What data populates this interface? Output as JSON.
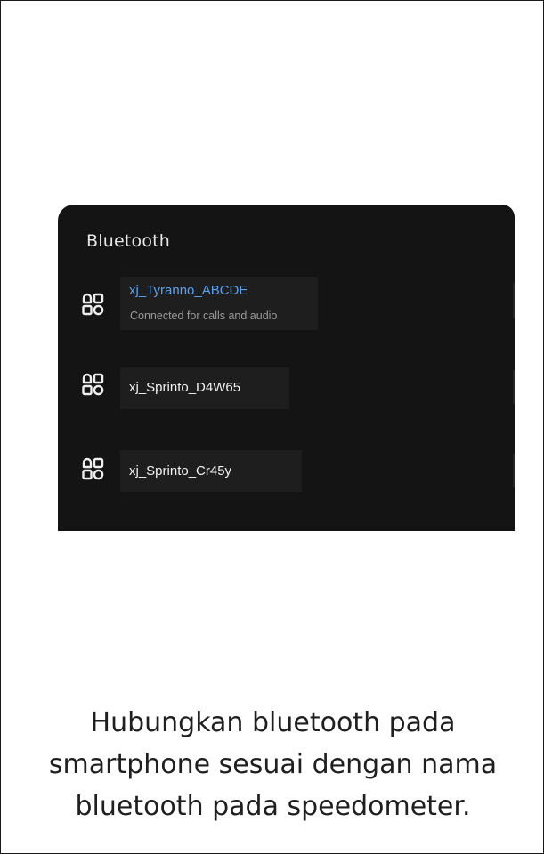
{
  "bluetooth_panel": {
    "title": "Bluetooth",
    "devices": [
      {
        "name": "xj_Tyranno_ABCDE",
        "status": "Connected for calls and audio",
        "icon": "device-grid-icon",
        "connected": true
      },
      {
        "name": "xj_Sprinto_D4W65",
        "status": "",
        "icon": "device-grid-icon",
        "connected": false
      },
      {
        "name": "xj_Sprinto_Cr45y",
        "status": "",
        "icon": "device-grid-icon",
        "connected": false
      }
    ]
  },
  "caption": {
    "lines": [
      "Hubungkan bluetooth pada",
      "smartphone sesuai dengan nama",
      "bluetooth pada speedometer."
    ]
  },
  "colors": {
    "panel_background": "#141414",
    "item_background": "#1e1e1e",
    "connected_name": "#5aa0ec",
    "text_light": "#f2f2f2",
    "status_text": "#9a9a9a",
    "caption_text": "#1f1f1f"
  }
}
